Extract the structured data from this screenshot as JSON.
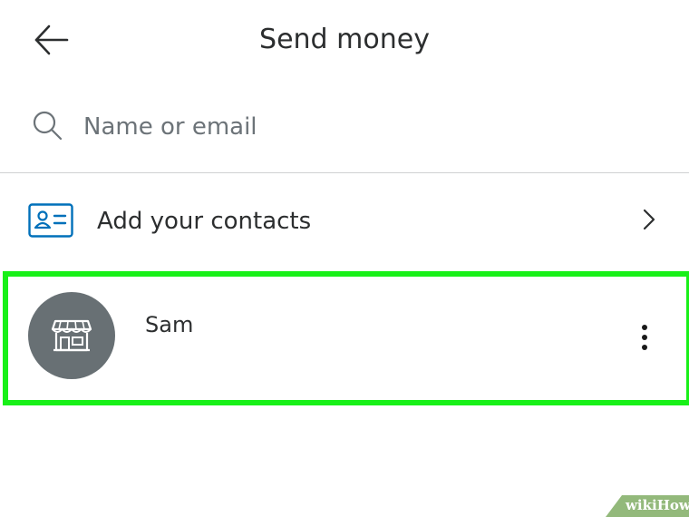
{
  "header": {
    "title": "Send money"
  },
  "search": {
    "placeholder": "Name or email",
    "value": ""
  },
  "contacts_row": {
    "label": "Add your contacts"
  },
  "contact": {
    "name": "Sam"
  },
  "colors": {
    "highlight": "#18f018",
    "avatar_bg": "#687074",
    "accent_blue": "#0070ba"
  },
  "icons": {
    "back": "arrow-left-icon",
    "search": "search-icon",
    "contacts": "contact-card-icon",
    "chevron": "chevron-right-icon",
    "store": "storefront-icon",
    "more": "more-vertical-icon"
  },
  "watermark": {
    "text": "wikiHow"
  }
}
